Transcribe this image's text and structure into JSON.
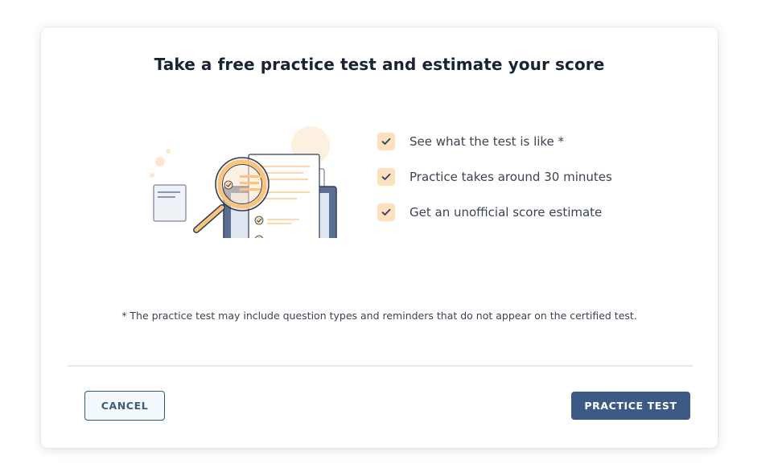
{
  "modal": {
    "title": "Take a free practice test and estimate your score",
    "features": [
      {
        "label": "See what the test is like *",
        "icon": "check-icon"
      },
      {
        "label": "Practice takes around 30 minutes",
        "icon": "check-icon"
      },
      {
        "label": "Get an unofficial score estimate",
        "icon": "check-icon"
      }
    ],
    "footnote": "* The practice test may include question types and reminders that do not appear on the certified test.",
    "illustration": "magnifier-over-laptop-test-illustration",
    "buttons": {
      "cancel_label": "CANCEL",
      "practice_label": "PRACTICE TEST"
    }
  },
  "colors": {
    "primary_button": "#3d5a85",
    "cancel_border": "#2e5e77",
    "check_bg": "#fde0bd",
    "title_text": "#1a2333"
  }
}
